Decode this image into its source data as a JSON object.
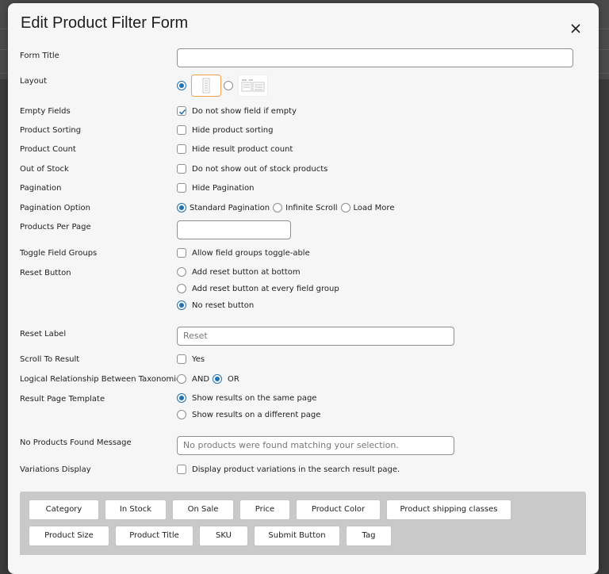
{
  "dialog": {
    "title": "Edit Product Filter Form"
  },
  "fields": {
    "form_title": {
      "label": "Form Title",
      "value": ""
    },
    "layout": {
      "label": "Layout",
      "selected": "vertical"
    },
    "empty_fields": {
      "label": "Empty Fields",
      "option": "Do not show field if empty",
      "checked": true
    },
    "product_sorting": {
      "label": "Product Sorting",
      "option": "Hide product sorting",
      "checked": false
    },
    "product_count": {
      "label": "Product Count",
      "option": "Hide result product count",
      "checked": false
    },
    "out_of_stock": {
      "label": "Out of Stock",
      "option": "Do not show out of stock products",
      "checked": false
    },
    "pagination": {
      "label": "Pagination",
      "option": "Hide Pagination",
      "checked": false
    },
    "pagination_option": {
      "label": "Pagination Option",
      "options": [
        "Standard Pagination",
        "Infinite Scroll",
        "Load More"
      ],
      "selected": "Standard Pagination"
    },
    "products_per_page": {
      "label": "Products Per Page",
      "value": ""
    },
    "toggle_field_groups": {
      "label": "Toggle Field Groups",
      "option": "Allow field groups toggle-able",
      "checked": false
    },
    "reset_button": {
      "label": "Reset Button",
      "options": [
        "Add reset button at bottom",
        "Add reset button at every field group",
        "No reset button"
      ],
      "selected": "No reset button"
    },
    "reset_label": {
      "label": "Reset Label",
      "placeholder": "Reset"
    },
    "scroll_to_result": {
      "label": "Scroll To Result",
      "option": "Yes",
      "checked": false
    },
    "logical_relationship": {
      "label": "Logical Relationship Between Taxonomies",
      "options": [
        "AND",
        "OR"
      ],
      "selected": "OR"
    },
    "result_page_template": {
      "label": "Result Page Template",
      "options": [
        "Show results on the same page",
        "Show results on a different page"
      ],
      "selected": "Show results on the same page"
    },
    "no_products_message": {
      "label": "No Products Found Message",
      "placeholder": "No products were found matching your selection."
    },
    "variations_display": {
      "label": "Variations Display",
      "option": "Display product variations in the search result page.",
      "checked": false
    }
  },
  "filter_items": {
    "row1": [
      "Category",
      "In Stock",
      "On Sale",
      "Price",
      "Product Color",
      "Product shipping classes"
    ],
    "row2": [
      "Product Size",
      "Product Title",
      "SKU",
      "Submit Button",
      "Tag"
    ]
  },
  "colors": {
    "accent": "#2271b1",
    "layout_selected_border": "#f0a04b",
    "tray": "#c9c9c9"
  },
  "icons": {
    "close": "close-icon",
    "check": "checkmark-icon"
  }
}
